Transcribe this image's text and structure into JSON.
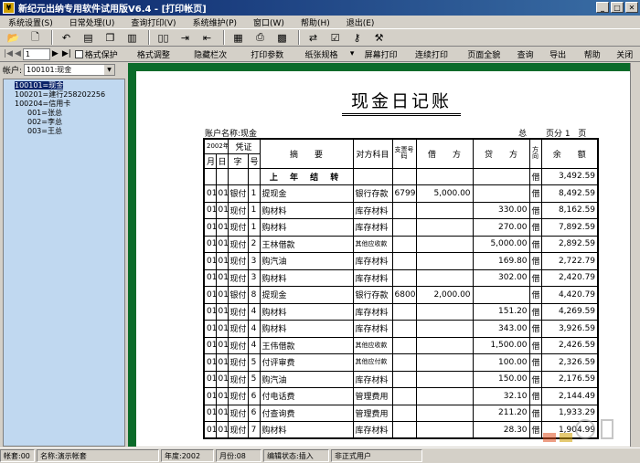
{
  "window": {
    "title": "新纪元出纳专用软件试用版V6.4 - [打印帐页]"
  },
  "menu": {
    "items": [
      "系统设置(S)",
      "日常处理(U)",
      "查询打印(V)",
      "系统维护(P)",
      "窗口(W)",
      "帮助(H)",
      "退出(E)"
    ]
  },
  "toolbar2": {
    "page_value": "1",
    "items": [
      "格式保护",
      "格式调整",
      "隐藏栏次",
      "打印参数",
      "纸张规格",
      "屏幕打印",
      "连续打印",
      "页面全貌",
      "查询",
      "导出",
      "帮助",
      "关闭"
    ]
  },
  "account_selector": {
    "label": "帐户:",
    "value": "100101:现金"
  },
  "tree": {
    "nodes": [
      "100101=现金",
      "100201=建行258202256",
      "100204=信用卡",
      "001=张总",
      "002=李总",
      "003=王总"
    ]
  },
  "document": {
    "title": "现金日记账",
    "account": "账户名称:现金",
    "total_label": "总",
    "page_label": "页分",
    "page_number": "1",
    "page_suffix": "页",
    "header": {
      "year": "2002年",
      "voucher": "凭证",
      "month": "月",
      "day": "日",
      "char": "字",
      "num": "号",
      "summary": "摘　　要",
      "counter": "对方科目",
      "cheque": "支票号码",
      "debit": "借　　方",
      "credit": "贷　　方",
      "direction": "方向",
      "balance": "余　　额"
    },
    "opening": {
      "summary": "上 年 结 转",
      "direction": "借",
      "balance": "3,492.59"
    },
    "rows": [
      {
        "m": "01",
        "d": "01",
        "z": "银付",
        "n": "1",
        "summary": "提现金",
        "counter": "银行存款",
        "cheque": "6799",
        "debit": "5,000.00",
        "credit": "",
        "dir": "借",
        "balance": "8,492.59"
      },
      {
        "m": "01",
        "d": "01",
        "z": "现付",
        "n": "1",
        "summary": "购材料",
        "counter": "库存材料",
        "cheque": "",
        "debit": "",
        "credit": "330.00",
        "dir": "借",
        "balance": "8,162.59"
      },
      {
        "m": "01",
        "d": "01",
        "z": "现付",
        "n": "1",
        "summary": "购材料",
        "counter": "库存材料",
        "cheque": "",
        "debit": "",
        "credit": "270.00",
        "dir": "借",
        "balance": "7,892.59"
      },
      {
        "m": "01",
        "d": "01",
        "z": "现付",
        "n": "2",
        "summary": "王林借款",
        "counter": "其他应收款",
        "cheque": "",
        "debit": "",
        "credit": "5,000.00",
        "dir": "借",
        "balance": "2,892.59"
      },
      {
        "m": "01",
        "d": "01",
        "z": "现付",
        "n": "3",
        "summary": "购汽油",
        "counter": "库存材料",
        "cheque": "",
        "debit": "",
        "credit": "169.80",
        "dir": "借",
        "balance": "2,722.79"
      },
      {
        "m": "01",
        "d": "01",
        "z": "现付",
        "n": "3",
        "summary": "购材料",
        "counter": "库存材料",
        "cheque": "",
        "debit": "",
        "credit": "302.00",
        "dir": "借",
        "balance": "2,420.79"
      },
      {
        "m": "01",
        "d": "01",
        "z": "银付",
        "n": "8",
        "summary": "提现金",
        "counter": "银行存款",
        "cheque": "6800",
        "debit": "2,000.00",
        "credit": "",
        "dir": "借",
        "balance": "4,420.79"
      },
      {
        "m": "01",
        "d": "01",
        "z": "现付",
        "n": "4",
        "summary": "购材料",
        "counter": "库存材料",
        "cheque": "",
        "debit": "",
        "credit": "151.20",
        "dir": "借",
        "balance": "4,269.59"
      },
      {
        "m": "01",
        "d": "01",
        "z": "现付",
        "n": "4",
        "summary": "购材料",
        "counter": "库存材料",
        "cheque": "",
        "debit": "",
        "credit": "343.00",
        "dir": "借",
        "balance": "3,926.59"
      },
      {
        "m": "01",
        "d": "01",
        "z": "现付",
        "n": "4",
        "summary": "王伟借款",
        "counter": "其他应收款",
        "cheque": "",
        "debit": "",
        "credit": "1,500.00",
        "dir": "借",
        "balance": "2,426.59"
      },
      {
        "m": "01",
        "d": "01",
        "z": "现付",
        "n": "5",
        "summary": "付评审费",
        "counter": "其他应付款",
        "cheque": "",
        "debit": "",
        "credit": "100.00",
        "dir": "借",
        "balance": "2,326.59"
      },
      {
        "m": "01",
        "d": "01",
        "z": "现付",
        "n": "5",
        "summary": "购汽油",
        "counter": "库存材料",
        "cheque": "",
        "debit": "",
        "credit": "150.00",
        "dir": "借",
        "balance": "2,176.59"
      },
      {
        "m": "01",
        "d": "01",
        "z": "现付",
        "n": "6",
        "summary": "付电话费",
        "counter": "管理费用",
        "cheque": "",
        "debit": "",
        "credit": "32.10",
        "dir": "借",
        "balance": "2,144.49"
      },
      {
        "m": "01",
        "d": "01",
        "z": "现付",
        "n": "6",
        "summary": "付查询费",
        "counter": "管理费用",
        "cheque": "",
        "debit": "",
        "credit": "211.20",
        "dir": "借",
        "balance": "1,933.29"
      },
      {
        "m": "01",
        "d": "01",
        "z": "现付",
        "n": "7",
        "summary": "购材料",
        "counter": "库存材料",
        "cheque": "",
        "debit": "",
        "credit": "28.30",
        "dir": "借",
        "balance": "1,904.99"
      }
    ]
  },
  "status": {
    "ledger_set": "帐套:00",
    "name": "名称:演示帐套",
    "year": "年度:2002",
    "month": "月份:08",
    "edit_state": "编辑状态:插入",
    "user": "非正式用户"
  },
  "colors": {
    "title_bar": "#0a246a",
    "frame_green": "#0b6b2a",
    "tree_bg": "#c0d8f0"
  }
}
